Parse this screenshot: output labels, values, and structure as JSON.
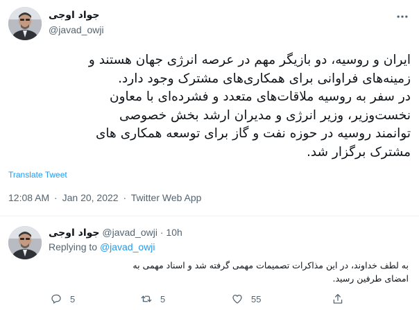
{
  "main_tweet": {
    "display_name": "جواد اوجی",
    "handle": "@javad_owji",
    "text": "ایران و روسیه، دو بازیگر مهم در عرصه انرژی جهان هستند و\nزمینه‌های فراوانی برای همکاری‌های مشترک وجود دارد.\nدر سفر به روسیه ملاقات‌های متعدد و فشرده‌ای با معاون\nنخست‌وزیر، وزیر انرژی و مدیران ارشد بخش خصوصی\nتوانمند روسیه در حوزه نفت و گاز برای توسعه همکاری های\nمشترک برگزار شد.",
    "translate_label": "Translate Tweet",
    "time": "12:08 AM",
    "date": "Jan 20, 2022",
    "source": "Twitter Web App",
    "separator": "·"
  },
  "reply_tweet": {
    "display_name": "جواد اوجی",
    "handle": "@javad_owji",
    "age": "10h",
    "separator": "·",
    "replying_prefix": "Replying to",
    "replying_handle": "@javad_owji",
    "text": "به لطف خداوند، در این مذاکرات تصمیمات مهمی گرفته شد و اسناد مهمی به\nامضای طرفین رسید.",
    "actions": {
      "reply_count": "5",
      "retweet_count": "5",
      "like_count": "55"
    }
  },
  "icons": {
    "more": "more-icon",
    "reply": "reply-icon",
    "retweet": "retweet-icon",
    "like": "heart-icon",
    "share": "share-icon"
  },
  "colors": {
    "link": "#1d9bf0",
    "secondary_text": "#536471",
    "primary_text": "#0f1419",
    "divider": "#eff3f4"
  }
}
